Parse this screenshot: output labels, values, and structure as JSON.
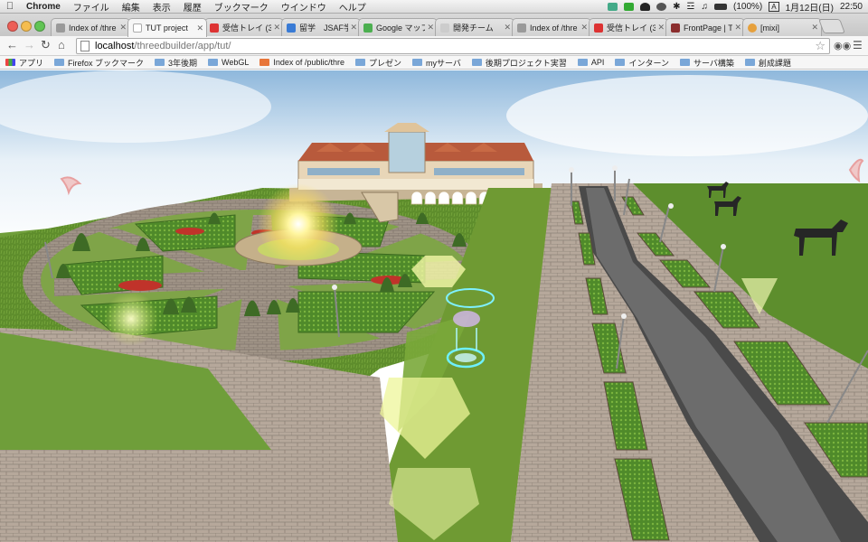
{
  "menubar": {
    "app_name": "Chrome",
    "items": [
      "ファイル",
      "編集",
      "表示",
      "履歴",
      "ブックマーク",
      "ウインドウ",
      "ヘルプ"
    ],
    "battery": "(100%)",
    "date": "1月12日(日)",
    "time": "22:50"
  },
  "tabs": [
    {
      "title": "Index of /thre",
      "fav": "#9a9a9a"
    },
    {
      "title": "TUT project",
      "fav": "#ffffff",
      "active": true
    },
    {
      "title": "受信トレイ (33",
      "fav": "#d33"
    },
    {
      "title": "留学　JSAF学部",
      "fav": "#3a7bd5"
    },
    {
      "title": "Google マップ",
      "fav": "#4caf50"
    },
    {
      "title": "開発チーム　m",
      "fav": "#cccccc"
    },
    {
      "title": "Index of /thre",
      "fav": "#9a9a9a"
    },
    {
      "title": "受信トレイ (33",
      "fav": "#d33"
    },
    {
      "title": "FrontPage | T",
      "fav": "#8b2e2e"
    },
    {
      "title": "[mixi]",
      "fav": "#e6a03c"
    }
  ],
  "address": {
    "host": "localhost",
    "path": "/threedbuilder/app/tut/"
  },
  "bookmarks": [
    {
      "label": "アプリ",
      "kind": "apps"
    },
    {
      "label": "Firefox ブックマーク",
      "kind": "folder"
    },
    {
      "label": "3年後期",
      "kind": "folder"
    },
    {
      "label": "WebGL",
      "kind": "folder"
    },
    {
      "label": "Index of /public/thre",
      "kind": "page"
    },
    {
      "label": "プレゼン",
      "kind": "folder"
    },
    {
      "label": "myサーバ",
      "kind": "folder"
    },
    {
      "label": "後期プロジェクト実習",
      "kind": "folder"
    },
    {
      "label": "API",
      "kind": "folder"
    },
    {
      "label": "インターン",
      "kind": "folder"
    },
    {
      "label": "サーバ構築",
      "kind": "folder"
    },
    {
      "label": "創成課題",
      "kind": "folder"
    }
  ],
  "colors": {
    "grass": "#5f8f2f",
    "brick": "#b9a99a",
    "path_dark": "#5a5a5a",
    "sky": "#dbe9f4"
  }
}
